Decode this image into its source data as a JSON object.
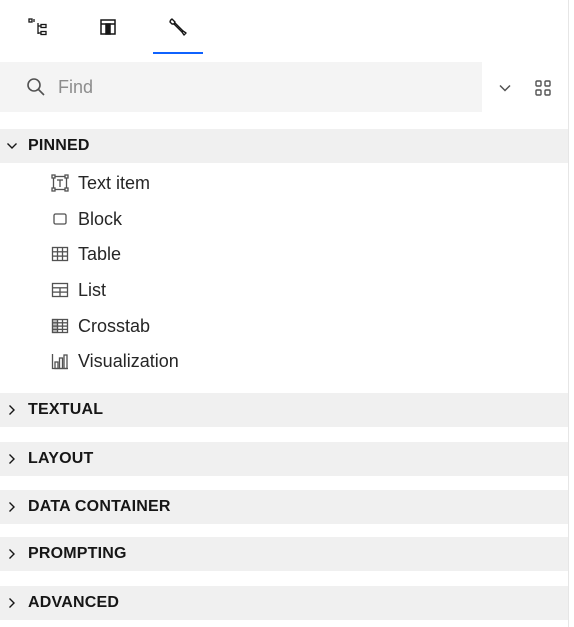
{
  "tabs": [
    {
      "icon": "hierarchy-icon"
    },
    {
      "icon": "properties-panel-icon"
    },
    {
      "icon": "toolbox-wrench-icon",
      "active": true
    }
  ],
  "search": {
    "placeholder": "Find",
    "value": ""
  },
  "sections": {
    "pinned": {
      "label": "PINNED",
      "expanded": true,
      "items": [
        {
          "label": "Text item",
          "icon": "text-item-icon"
        },
        {
          "label": "Block",
          "icon": "block-icon"
        },
        {
          "label": "Table",
          "icon": "table-icon"
        },
        {
          "label": "List",
          "icon": "list-icon"
        },
        {
          "label": "Crosstab",
          "icon": "crosstab-icon"
        },
        {
          "label": "Visualization",
          "icon": "visualization-icon"
        }
      ]
    },
    "textual": {
      "label": "TEXTUAL",
      "expanded": false
    },
    "layout": {
      "label": "LAYOUT",
      "expanded": false
    },
    "data_container": {
      "label": "DATA CONTAINER",
      "expanded": false
    },
    "prompting": {
      "label": "PROMPTING",
      "expanded": false
    },
    "advanced": {
      "label": "ADVANCED",
      "expanded": false
    }
  },
  "colors": {
    "accent": "#0f62fe",
    "header_bg": "#f0f0f0",
    "search_bg": "#f4f4f4",
    "icon": "#525252"
  }
}
